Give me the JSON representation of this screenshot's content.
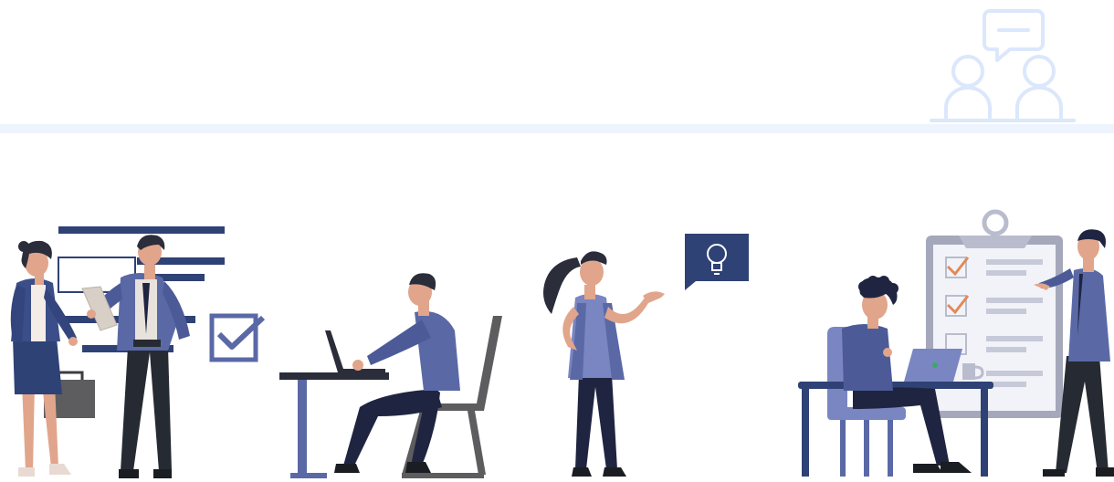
{
  "colors": {
    "navy": "#2f4275",
    "slate": "#5a69a6",
    "periwinkle": "#7a86c2",
    "dark_pants": "#1f2540",
    "skin": "#e1a58c",
    "hair": "#2b2d3a",
    "grey_case": "#5d5d5f",
    "light_blue": "#dbe7fb",
    "band": "#eef4fd",
    "check_orange": "#e28a57",
    "clipboard_frame": "#a5a8bb",
    "clipboard_paper": "#f2f3f8",
    "line_grey": "#c6c9d8"
  },
  "icons": {
    "meeting": "people-chat-icon",
    "idea": "lightbulb-icon",
    "task": "checkbox-icon"
  }
}
